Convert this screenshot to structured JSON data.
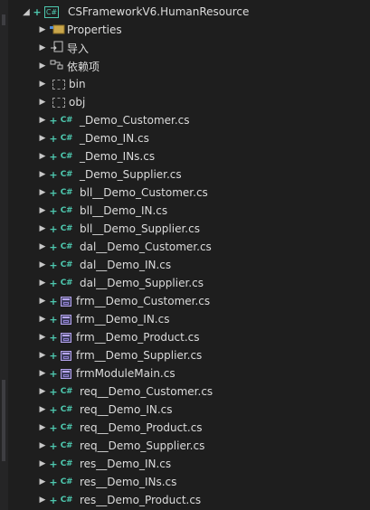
{
  "project": {
    "name": "CSFrameworkV6.HumanResource",
    "icon": "csproj-icon"
  },
  "nodes": [
    {
      "label": "Properties",
      "kind": "properties",
      "icon": "wrench-folder-icon"
    },
    {
      "label": "导入",
      "kind": "imports",
      "icon": "import-icon"
    },
    {
      "label": "依赖项",
      "kind": "dependencies",
      "icon": "dependencies-icon"
    },
    {
      "label": "bin",
      "kind": "folder",
      "icon": "folder-icon"
    },
    {
      "label": "obj",
      "kind": "folder",
      "icon": "folder-icon"
    },
    {
      "label": "_Demo_Customer.cs",
      "kind": "cs"
    },
    {
      "label": "_Demo_IN.cs",
      "kind": "cs"
    },
    {
      "label": "_Demo_INs.cs",
      "kind": "cs"
    },
    {
      "label": "_Demo_Supplier.cs",
      "kind": "cs"
    },
    {
      "label": "bll__Demo_Customer.cs",
      "kind": "cs"
    },
    {
      "label": "bll__Demo_IN.cs",
      "kind": "cs"
    },
    {
      "label": "bll__Demo_Supplier.cs",
      "kind": "cs"
    },
    {
      "label": "dal__Demo_Customer.cs",
      "kind": "cs"
    },
    {
      "label": "dal__Demo_IN.cs",
      "kind": "cs"
    },
    {
      "label": "dal__Demo_Supplier.cs",
      "kind": "cs"
    },
    {
      "label": "frm__Demo_Customer.cs",
      "kind": "form"
    },
    {
      "label": "frm__Demo_IN.cs",
      "kind": "form"
    },
    {
      "label": "frm__Demo_Product.cs",
      "kind": "form"
    },
    {
      "label": "frm__Demo_Supplier.cs",
      "kind": "form"
    },
    {
      "label": "frmModuleMain.cs",
      "kind": "form"
    },
    {
      "label": "req__Demo_Customer.cs",
      "kind": "cs"
    },
    {
      "label": "req__Demo_IN.cs",
      "kind": "cs"
    },
    {
      "label": "req__Demo_Product.cs",
      "kind": "cs"
    },
    {
      "label": "req__Demo_Supplier.cs",
      "kind": "cs"
    },
    {
      "label": "res__Demo_IN.cs",
      "kind": "cs"
    },
    {
      "label": "res__Demo_INs.cs",
      "kind": "cs"
    },
    {
      "label": "res__Demo_Product.cs",
      "kind": "cs"
    }
  ],
  "icons": {
    "expand_closed": "triangle-right-icon",
    "expand_open": "triangle-down-icon",
    "git_added": "plus-icon",
    "cs_file": "csharp-file-icon",
    "form_file": "form-file-icon"
  },
  "colors": {
    "background": "#1e1e1e",
    "text": "#dcdcdc",
    "git_added": "#4ec9b0",
    "form_icon": "#b7a6f0"
  },
  "glyphs": {
    "cs": "C#",
    "plus": "+",
    "expand_closed": "▶",
    "expand_open": "◢"
  }
}
